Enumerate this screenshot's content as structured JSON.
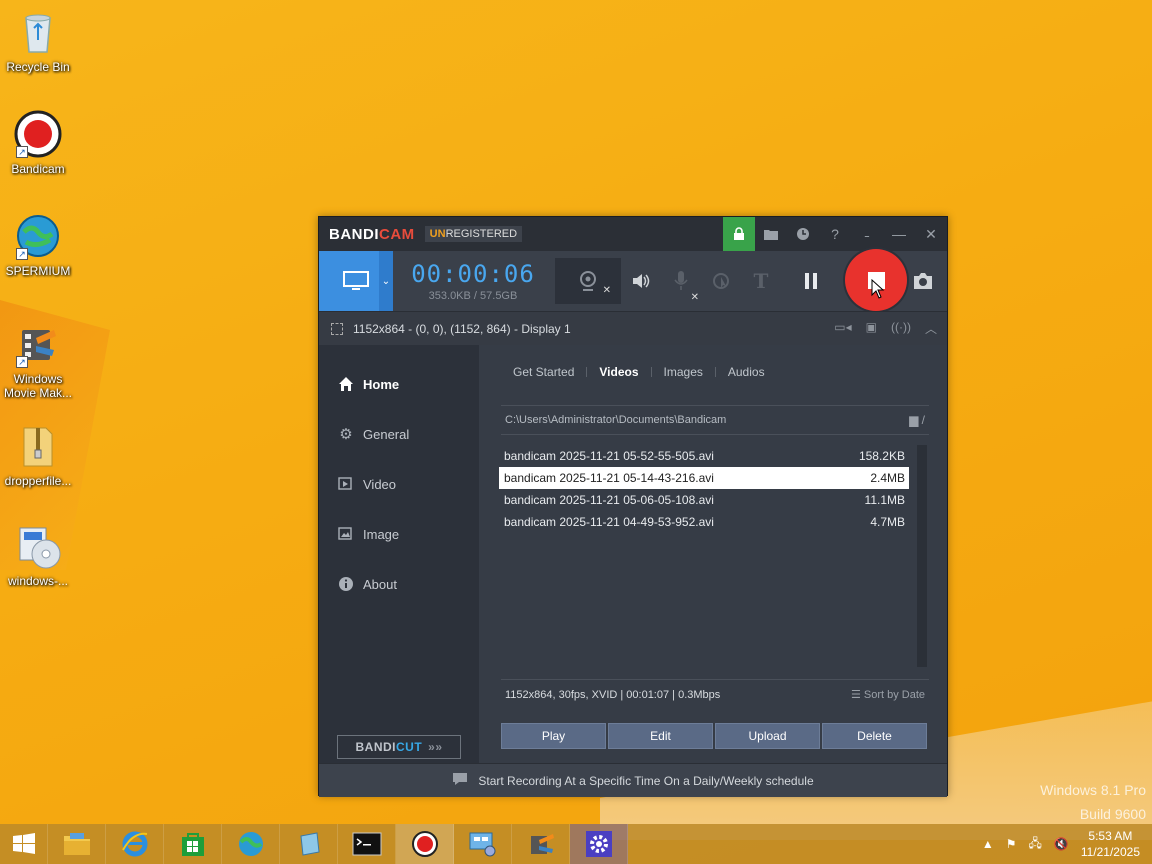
{
  "desktop": {
    "icons": [
      {
        "label": "Recycle Bin",
        "icon": "recycle-bin-icon"
      },
      {
        "label": "Bandicam",
        "icon": "bandicam-icon"
      },
      {
        "label": "SPERMIUM",
        "icon": "globe-icon"
      },
      {
        "label": "Windows Movie Mak...",
        "icon": "movie-maker-icon"
      },
      {
        "label": "dropperfile...",
        "icon": "zip-folder-icon"
      },
      {
        "label": "windows-...",
        "icon": "disc-installer-icon"
      }
    ],
    "watermark": {
      "line1": "Windows 8.1 Pro",
      "line2": "Build 9600"
    }
  },
  "bandicam": {
    "logo_a": "BANDI",
    "logo_b": "CAM",
    "unreg_a": "UN",
    "unreg_b": "REGISTERED",
    "timer": "00:00:06",
    "size": "353.0KB / 57.5GB",
    "area": "1152x864 - (0, 0), (1152, 864) - Display 1",
    "sidebar": [
      {
        "label": "Home",
        "icon": "home-icon"
      },
      {
        "label": "General",
        "icon": "gear-icon"
      },
      {
        "label": "Video",
        "icon": "video-settings-icon"
      },
      {
        "label": "Image",
        "icon": "image-settings-icon"
      },
      {
        "label": "About",
        "icon": "info-icon"
      }
    ],
    "bandicut_a": "BANDI",
    "bandicut_b": "CUT",
    "tabs": [
      "Get Started",
      "Videos",
      "Images",
      "Audios"
    ],
    "path": "C:\\Users\\Administrator\\Documents\\Bandicam",
    "path_suffix": "/",
    "files": [
      {
        "name": "bandicam 2025-11-21 05-52-55-505.avi",
        "size": "158.2KB"
      },
      {
        "name": "bandicam 2025-11-21 05-14-43-216.avi",
        "size": "2.4MB"
      },
      {
        "name": "bandicam 2025-11-21 05-06-05-108.avi",
        "size": "11.1MB"
      },
      {
        "name": "bandicam 2025-11-21 04-49-53-952.avi",
        "size": "4.7MB"
      }
    ],
    "info": "1152x864, 30fps, XVID | 00:01:07 | 0.3Mbps",
    "sort": "Sort by Date",
    "actions": [
      "Play",
      "Edit",
      "Upload",
      "Delete"
    ],
    "status": "Start Recording At a Specific Time On a Daily/Weekly schedule"
  },
  "taskbar": {
    "clock_time": "5:53 AM",
    "clock_date": "11/21/2025"
  },
  "colors": {
    "accent": "#3c8fe0",
    "record": "#e8322d",
    "lock": "#39a34a"
  }
}
